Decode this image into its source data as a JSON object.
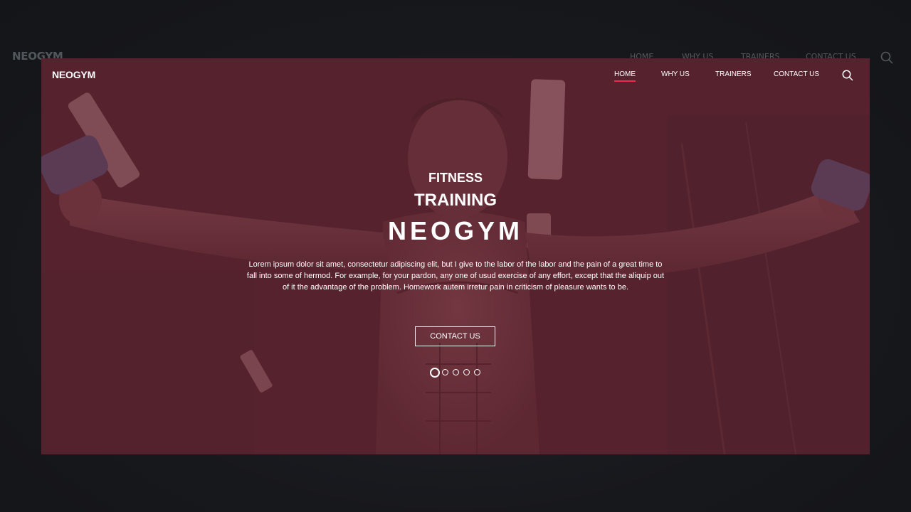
{
  "background": {
    "logo": "NEOGYM",
    "nav": [
      "HOME",
      "WHY US",
      "TRAINERS",
      "CONTACT US"
    ],
    "search_icon": "search-icon"
  },
  "header": {
    "logo": "NEOGYM",
    "nav": [
      {
        "label": "HOME",
        "active": true
      },
      {
        "label": "WHY US",
        "active": false
      },
      {
        "label": "TRAINERS",
        "active": false
      },
      {
        "label": "CONTACT US",
        "active": false
      }
    ],
    "search_icon": "search-icon"
  },
  "hero": {
    "line1": "FITNESS",
    "line2": "TRAINING",
    "line3": "NEOGYM",
    "description": "Lorem ipsum dolor sit amet, consectetur adipiscing elit, but I give to the labor of the labor and the pain of a great time to fall into some of hermod. For example, for your pardon, any one of usud exercise of any effort, except that the aliquip out of it the advantage of the problem. Homework autem irretur pain in criticism of pleasure wants to be.",
    "cta": "CONTACT US"
  },
  "carousel": {
    "slides": 5,
    "active_index": 0
  },
  "colors": {
    "accent": "#ee2a4d",
    "overlay": "#55262f",
    "page_bg": "#16171b"
  }
}
